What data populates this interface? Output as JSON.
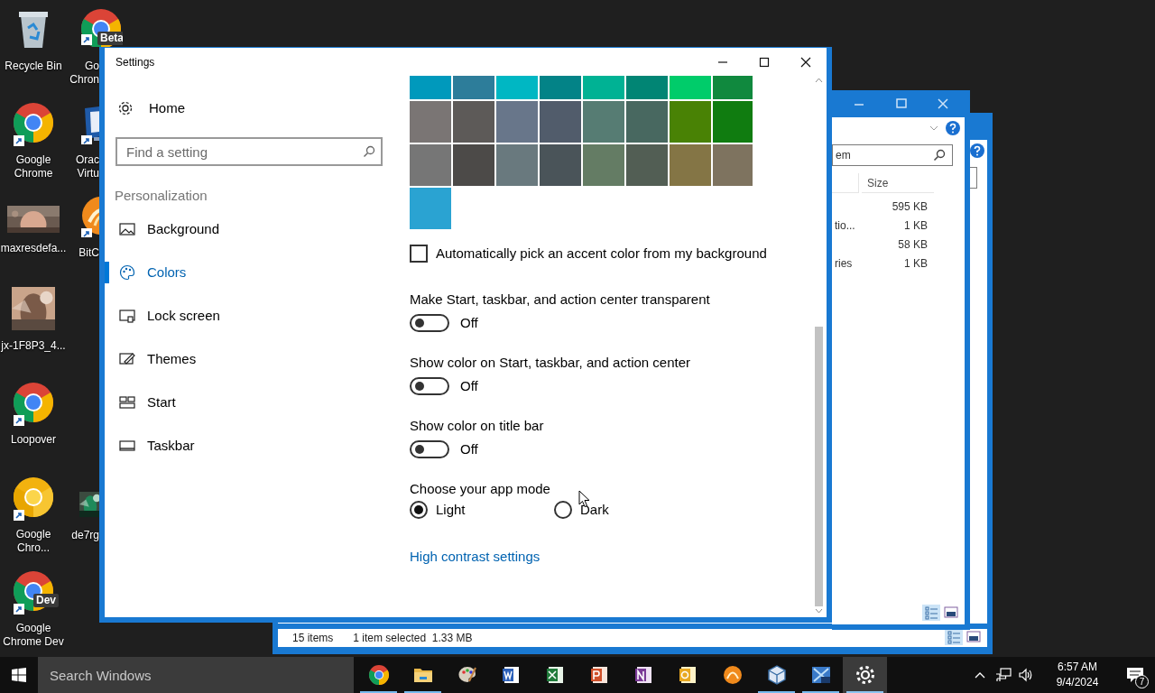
{
  "desktop_icons": [
    {
      "kind": "recycle",
      "label_lines": [
        "Recycle Bin"
      ]
    },
    {
      "kind": "chrome",
      "shortcut": true,
      "label_lines": [
        "Google",
        "Chrome"
      ]
    },
    {
      "kind": "picture",
      "label_lines": [
        "maxresdefa..."
      ]
    },
    {
      "kind": "picture",
      "label_lines": [
        "jx-1F8P3_4..."
      ]
    },
    {
      "kind": "chrome",
      "shortcut": true,
      "label_lines": [
        "Loopover"
      ]
    },
    {
      "kind": "chrome_canary",
      "shortcut": true,
      "label_lines": [
        "Google",
        "Chro..."
      ]
    },
    {
      "kind": "chrome",
      "badge": "Dev",
      "shortcut": true,
      "label_lines": [
        "Google",
        "Chrome Dev"
      ]
    },
    {
      "kind": "chrome",
      "badge": "Beta",
      "shortcut": true,
      "label_lines": [
        "Go",
        "Chron"
      ]
    },
    {
      "kind": "virtualbox",
      "shortcut": true,
      "label_lines": [
        "Orac",
        "Virtu"
      ]
    },
    {
      "kind": "bitcomet",
      "shortcut": true,
      "label_lines": [
        "BitC"
      ]
    },
    {
      "kind": "picture",
      "label_lines": [
        "de7rg"
      ]
    }
  ],
  "explorer_back": {
    "status_items": "15 items",
    "status_selection": "1 item selected  1.33 MB"
  },
  "explorer_front": {
    "search_value": "em",
    "size_header": "Size",
    "rows": [
      {
        "name": "",
        "size": "595 KB"
      },
      {
        "name": "tio...",
        "size": "1 KB"
      },
      {
        "name": "",
        "size": "58 KB"
      },
      {
        "name": "ries",
        "size": "1 KB"
      }
    ]
  },
  "settings": {
    "window": {
      "title": "Settings"
    },
    "sidebar": {
      "home": "Home",
      "search": {
        "placeholder": "Find a setting"
      },
      "section": "Personalization",
      "items": [
        {
          "label": "Background",
          "selected": false
        },
        {
          "label": "Colors",
          "selected": true
        },
        {
          "label": "Lock screen",
          "selected": false
        },
        {
          "label": "Themes",
          "selected": false
        },
        {
          "label": "Start",
          "selected": false
        },
        {
          "label": "Taskbar",
          "selected": false
        }
      ]
    },
    "accent_colors": [
      {
        "color": "#0099bc"
      },
      {
        "color": "#2d7d9a"
      },
      {
        "color": "#00b7c3"
      },
      {
        "color": "#038387"
      },
      {
        "color": "#00b294"
      },
      {
        "color": "#018574"
      },
      {
        "color": "#00cc6a"
      },
      {
        "color": "#10893e"
      },
      {
        "color": "#7a7574"
      },
      {
        "color": "#5d5a58"
      },
      {
        "color": "#68768a"
      },
      {
        "color": "#515c6b"
      },
      {
        "color": "#567c73"
      },
      {
        "color": "#486860"
      },
      {
        "color": "#498205"
      },
      {
        "color": "#107c10"
      },
      {
        "color": "#767676"
      },
      {
        "color": "#4c4a48"
      },
      {
        "color": "#69797e"
      },
      {
        "color": "#4a5459"
      },
      {
        "color": "#647c64"
      },
      {
        "color": "#525e54"
      },
      {
        "color": "#847545"
      },
      {
        "color": "#7e735f"
      },
      {
        "color": "#2aa3d2"
      }
    ],
    "auto_pick": {
      "label": "Automatically pick an accent color from my background",
      "checked": false
    },
    "toggles": [
      {
        "label": "Make Start, taskbar, and action center transparent",
        "on": false,
        "state_text": "Off"
      },
      {
        "label": "Show color on Start, taskbar, and action center",
        "on": false,
        "state_text": "Off"
      },
      {
        "label": "Show color on title bar",
        "on": false,
        "state_text": "Off"
      }
    ],
    "app_mode": {
      "label": "Choose your app mode",
      "options": [
        {
          "label": "Light",
          "selected": true
        },
        {
          "label": "Dark",
          "selected": false
        }
      ]
    },
    "link": "High contrast settings"
  },
  "taskbar": {
    "search_placeholder": "Search Windows",
    "apps": [
      {
        "kind": "chrome",
        "running": true,
        "active": false
      },
      {
        "kind": "folder",
        "running": true,
        "active": false
      },
      {
        "kind": "paint",
        "running": false,
        "active": false
      },
      {
        "kind": "word",
        "running": false,
        "active": false
      },
      {
        "kind": "excel",
        "running": false,
        "active": false
      },
      {
        "kind": "powerpoint",
        "running": false,
        "active": false
      },
      {
        "kind": "onenote",
        "running": false,
        "active": false
      },
      {
        "kind": "outlook",
        "running": false,
        "active": false
      },
      {
        "kind": "orange",
        "running": false,
        "active": false
      },
      {
        "kind": "virtualbox",
        "running": true,
        "active": false
      },
      {
        "kind": "xp",
        "running": true,
        "active": false
      },
      {
        "kind": "gear",
        "running": true,
        "active": true
      }
    ],
    "time": "6:57 AM",
    "date": "9/4/2024",
    "notification_count": "7"
  }
}
